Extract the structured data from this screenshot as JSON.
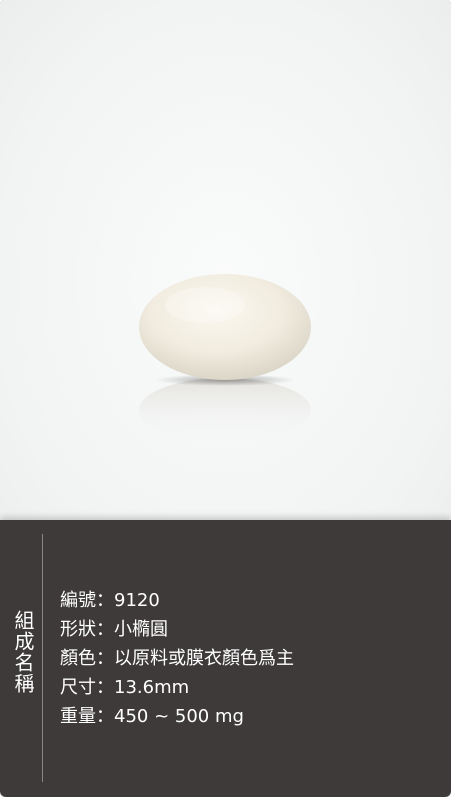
{
  "panel": {
    "title": "組成名稱",
    "specs": [
      {
        "label": "編號",
        "sep": "：",
        "value": "9120"
      },
      {
        "label": "形狀",
        "sep": "：",
        "value": "小橢圓"
      },
      {
        "label": "顏色",
        "sep": "：",
        "value": "以原料或膜衣顏色爲主"
      },
      {
        "label": "尺寸",
        "sep": "：",
        "value": "13.6mm"
      },
      {
        "label": "重量",
        "sep": "：",
        "value": "450 ~ 500 mg"
      }
    ]
  },
  "colors": {
    "photo_background": "#f3f5f5",
    "panel_background": "#3d3a39",
    "text": "#ffffff",
    "pill": "#f1ece1"
  }
}
